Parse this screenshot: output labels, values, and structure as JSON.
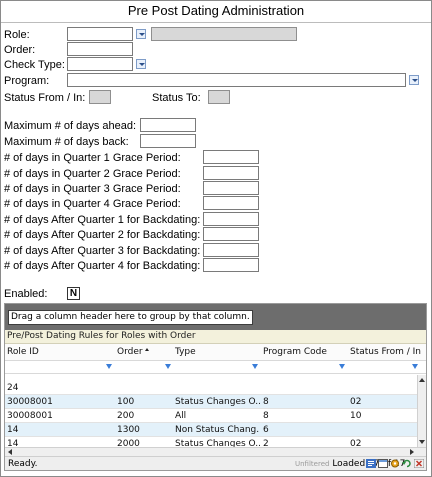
{
  "window": {
    "title": "Pre Post Dating Administration"
  },
  "form": {
    "role_label": "Role:",
    "order_label": "Order:",
    "check_type_label": "Check Type:",
    "program_label": "Program:",
    "status_from_label": "Status From / In:",
    "status_to_label": "Status To:",
    "max_ahead_label": "Maximum # of days ahead:",
    "max_back_label": "Maximum # of days back:",
    "q1_grace_label": "# of days in Quarter 1 Grace Period:",
    "q2_grace_label": "# of days in Quarter 2 Grace Period:",
    "q3_grace_label": "# of days in Quarter 3 Grace Period:",
    "q4_grace_label": "# of days in Quarter 4 Grace Period:",
    "q1_back_label": "# of days After Quarter 1 for Backdating:",
    "q2_back_label": "# of days After Quarter 2 for Backdating:",
    "q3_back_label": "# of days After Quarter 3 for Backdating:",
    "q4_back_label": "# of days After Quarter 4 for Backdating:",
    "enabled_label": "Enabled:",
    "enabled_value": "N"
  },
  "grid": {
    "group_hint": "Drag a column header here to group by that column.",
    "caption": "Pre/Post Dating Rules for Roles with Order",
    "columns": [
      "Role ID",
      "Order",
      "Type",
      "Program Code",
      "Status From / In"
    ],
    "rows": [
      [
        "24",
        "",
        "",
        "",
        ""
      ],
      [
        "30008001",
        "100",
        "Status Changes O...",
        "8",
        "02"
      ],
      [
        "30008001",
        "200",
        "All",
        "8",
        "10"
      ],
      [
        "14",
        "1300",
        "Non Status Chang...",
        "6",
        ""
      ],
      [
        "14",
        "2000",
        "Status Changes O...",
        "2",
        "02"
      ]
    ],
    "status_left": "Ready.",
    "status_unfiltered": "Unfiltered",
    "status_loaded": "Loaded 17 of 17"
  },
  "colors": {
    "grid_group_bg": "#6d6d6d",
    "caption_bg": "#f3f1dc",
    "row_alt": "#e3f1fa",
    "filter_icon": "#3a7dd8"
  },
  "icons": [
    "dropdown-arrow-icon",
    "filter-icon",
    "sort-ascending-icon",
    "scroll-up-icon",
    "scroll-down-icon",
    "scroll-left-icon",
    "scroll-right-icon",
    "export-icon",
    "settings-icon",
    "close-icon"
  ]
}
